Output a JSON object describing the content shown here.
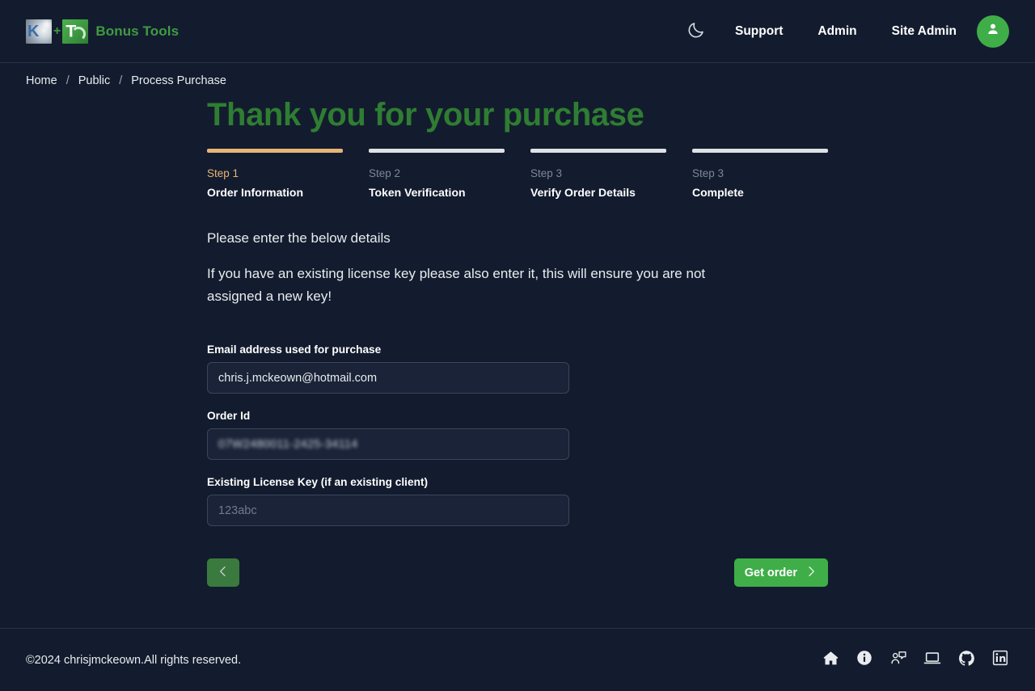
{
  "header": {
    "brand_text": "Bonus Tools",
    "logo_plus": "+",
    "theme_toggle_icon": "moon-icon",
    "nav_links": [
      {
        "label": "Support"
      },
      {
        "label": "Admin"
      },
      {
        "label": "Site Admin"
      }
    ],
    "avatar_icon": "user-icon"
  },
  "breadcrumb": {
    "separator": "/",
    "items": [
      {
        "label": "Home"
      },
      {
        "label": "Public"
      },
      {
        "label": "Process Purchase"
      }
    ]
  },
  "main": {
    "page_title": "Thank you for your purchase",
    "stepper": [
      {
        "number": "Step 1",
        "label": "Order Information",
        "state": "active"
      },
      {
        "number": "Step 2",
        "label": "Token Verification",
        "state": "inactive"
      },
      {
        "number": "Step 3",
        "label": "Verify Order Details",
        "state": "inactive"
      },
      {
        "number": "Step 3",
        "label": "Complete",
        "state": "inactive"
      }
    ],
    "lead_1": "Please enter the below details",
    "lead_2": "If you have an existing license key please also enter it, this will ensure you are not assigned a new key!",
    "fields": {
      "email": {
        "label": "Email address used for purchase",
        "value": "chris.j.mckeown@hotmail.com",
        "placeholder": ""
      },
      "order_id": {
        "label": "Order Id",
        "value": "07W2480011-2425-34114",
        "redacted": true
      },
      "license_key": {
        "label": "Existing License Key (if an existing client)",
        "value": "",
        "placeholder": "123abc"
      }
    },
    "buttons": {
      "back": {
        "label": "",
        "icon": "chevron-left-icon"
      },
      "next": {
        "label": "Get order",
        "icon": "chevron-right-icon"
      }
    }
  },
  "footer": {
    "copyright": "©2024 chrisjmckeown.All rights reserved.",
    "social_icons": [
      {
        "name": "home-icon"
      },
      {
        "name": "info-circle-icon"
      },
      {
        "name": "support-chat-icon"
      },
      {
        "name": "laptop-icon"
      },
      {
        "name": "github-icon"
      },
      {
        "name": "linkedin-icon"
      }
    ]
  },
  "colors": {
    "page_background": "#131c2e",
    "brand_green": "#3f9b42",
    "title_green": "#2f7d32",
    "accent_orange": "#e8b476",
    "button_green": "#3fae48",
    "border": "#2a3347"
  }
}
